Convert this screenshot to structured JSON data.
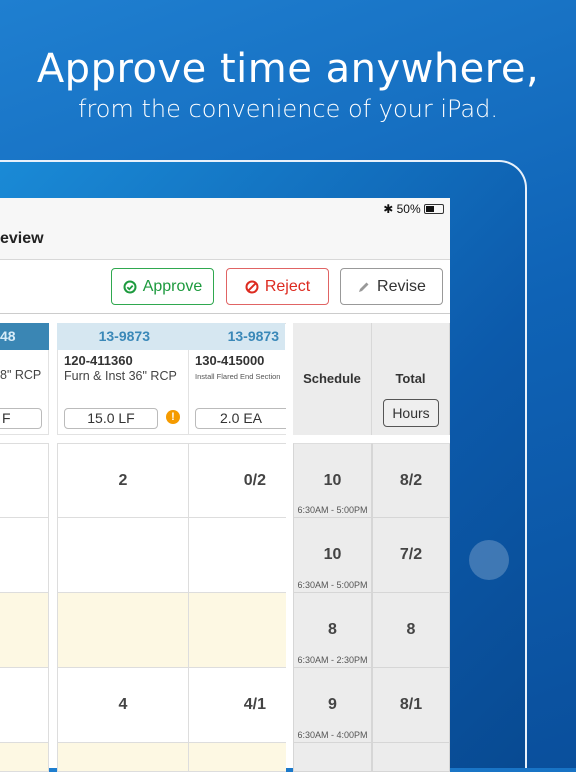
{
  "headline": "Approve time anywhere,",
  "subheadline": "from the convenience of your iPad.",
  "status": {
    "bluetooth": "✱",
    "battery": "50%",
    "battery_level": 0.5
  },
  "nav": {
    "title": "eview"
  },
  "actions": {
    "approve": "Approve",
    "reject": "Reject",
    "revise": "Revise"
  },
  "columns": [
    {
      "id": "48",
      "desc": "8\" RCP",
      "qty": "F"
    },
    {
      "id": "13-9873",
      "code": "120-411360",
      "desc": "Furn & Inst 36\" RCP",
      "qty": "15.0 LF",
      "warning": true
    },
    {
      "id": "13-9873",
      "code": "130-415000",
      "desc": "Install Flared End Section",
      "qty": "2.0 EA"
    }
  ],
  "schedule_header": "Schedule",
  "total_header": "Total",
  "hours_button": "Hours",
  "rows": [
    {
      "b": "2",
      "c": "0/2",
      "schedule": "10",
      "time": "6:30AM - 5:00PM",
      "total": "8/2",
      "highlight": false
    },
    {
      "b": "",
      "c": "",
      "schedule": "10",
      "time": "6:30AM - 5:00PM",
      "total": "7/2",
      "highlight": false
    },
    {
      "b": "",
      "c": "",
      "schedule": "8",
      "time": "6:30AM - 2:30PM",
      "total": "8",
      "highlight": true
    },
    {
      "b": "4",
      "c": "4/1",
      "schedule": "9",
      "time": "6:30AM - 4:00PM",
      "total": "8/1",
      "highlight": false
    },
    {
      "b": "",
      "c": "",
      "schedule": "",
      "time": "",
      "total": "",
      "highlight": true
    }
  ],
  "colors": {
    "approve": "#1d9a3e",
    "reject": "#dd2b20",
    "id_header": "#3a88b8",
    "highlight_row": "#fdf8e3",
    "warning": "#f59b00"
  }
}
